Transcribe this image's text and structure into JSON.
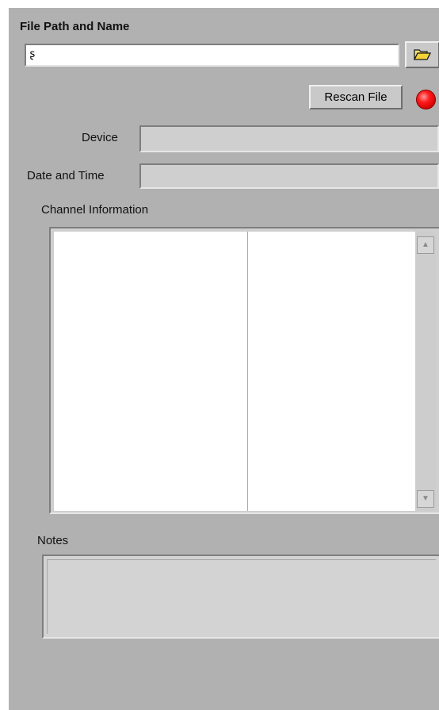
{
  "file_path": {
    "label": "File Path and Name",
    "value": "",
    "path_glyph": "ʂ",
    "browse_icon": "folder-open-icon"
  },
  "rescan_button": {
    "label": "Rescan File"
  },
  "status_led": {
    "color": "#ff1a1a",
    "state": "on"
  },
  "device": {
    "label": "Device",
    "value": ""
  },
  "date_time": {
    "label": "Date and Time",
    "value": ""
  },
  "channel_info": {
    "label": "Channel Information",
    "columns": [
      "",
      ""
    ],
    "rows": []
  },
  "notes": {
    "label": "Notes",
    "value": ""
  },
  "colors": {
    "panel_bg": "#b1b1b1",
    "field_bg": "#cfcfcf",
    "led_red": "#ff1a1a",
    "folder_yellow": "#f4d23a"
  }
}
